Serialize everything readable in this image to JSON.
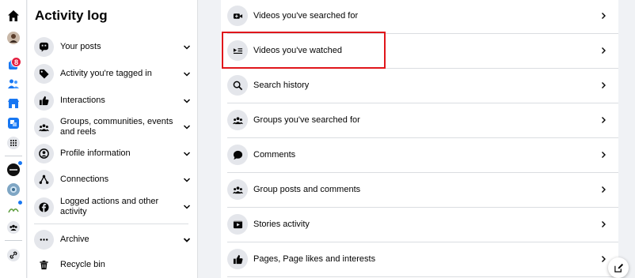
{
  "sidebar": {
    "title": "Activity log",
    "items": [
      {
        "label": "Your posts",
        "icon": "post-icon"
      },
      {
        "label": "Activity you're tagged in",
        "icon": "tag-icon"
      },
      {
        "label": "Interactions",
        "icon": "thumbs-up-icon"
      },
      {
        "label": "Groups, communities, events and reels",
        "icon": "groups-icon"
      },
      {
        "label": "Profile information",
        "icon": "profile-icon"
      },
      {
        "label": "Connections",
        "icon": "connections-icon"
      },
      {
        "label": "Logged actions and other activity",
        "icon": "facebook-icon"
      }
    ],
    "archive_label": "Archive",
    "recycle_label": "Recycle bin"
  },
  "rail": {
    "notification_count": "8"
  },
  "main": {
    "rows": [
      {
        "label": "Videos you've searched for",
        "icon": "video-search-icon"
      },
      {
        "label": "Videos you've watched",
        "icon": "video-watched-icon"
      },
      {
        "label": "Search history",
        "icon": "search-icon"
      },
      {
        "label": "Groups you've searched for",
        "icon": "groups-icon"
      },
      {
        "label": "Comments",
        "icon": "comment-icon"
      },
      {
        "label": "Group posts and comments",
        "icon": "groups-icon"
      },
      {
        "label": "Stories activity",
        "icon": "stories-icon"
      },
      {
        "label": "Pages, Page likes and interests",
        "icon": "thumbs-up-icon"
      }
    ]
  },
  "colors": {
    "highlight": "#e0161b",
    "accent": "#1877f2",
    "badge": "#e41e3f"
  }
}
